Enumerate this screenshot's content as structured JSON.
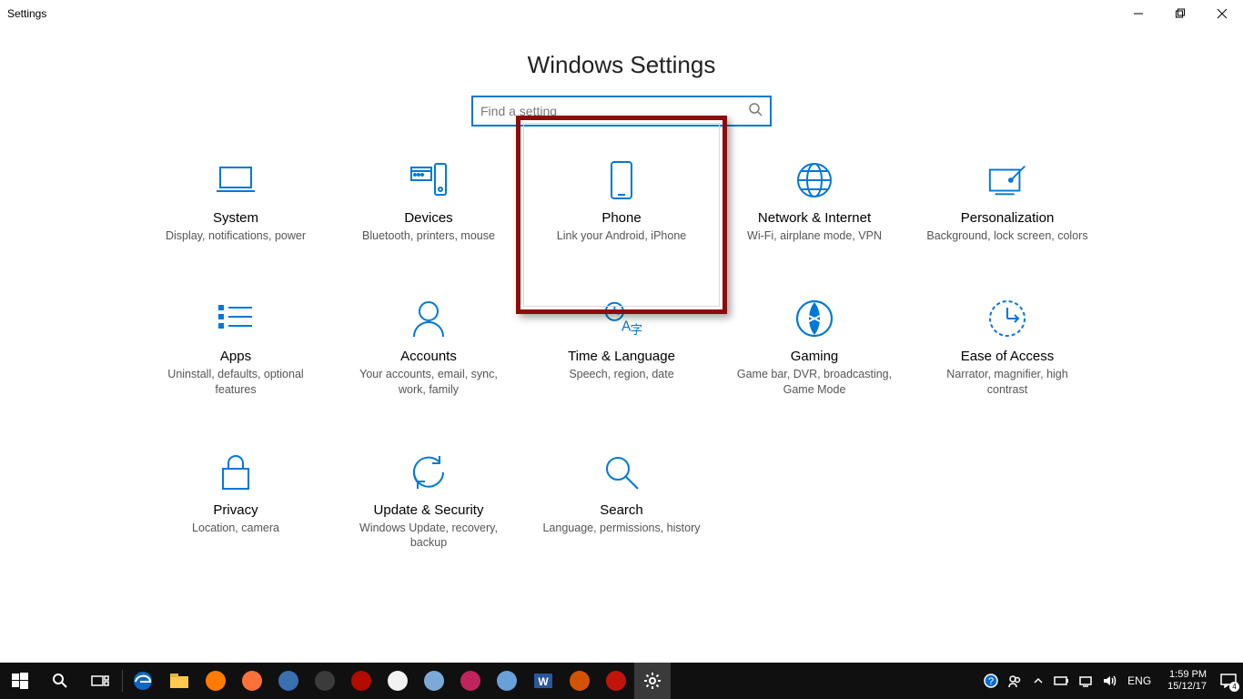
{
  "window": {
    "title": "Settings"
  },
  "header": {
    "title": "Windows Settings"
  },
  "search": {
    "placeholder": "Find a setting"
  },
  "categories": [
    {
      "id": "system",
      "name": "System",
      "desc": "Display, notifications, power",
      "highlighted": false
    },
    {
      "id": "devices",
      "name": "Devices",
      "desc": "Bluetooth, printers, mouse",
      "highlighted": false
    },
    {
      "id": "phone",
      "name": "Phone",
      "desc": "Link your Android, iPhone",
      "highlighted": true
    },
    {
      "id": "network",
      "name": "Network & Internet",
      "desc": "Wi-Fi, airplane mode, VPN",
      "highlighted": false
    },
    {
      "id": "personalization",
      "name": "Personalization",
      "desc": "Background, lock screen, colors",
      "highlighted": false
    },
    {
      "id": "apps",
      "name": "Apps",
      "desc": "Uninstall, defaults, optional features",
      "highlighted": false
    },
    {
      "id": "accounts",
      "name": "Accounts",
      "desc": "Your accounts, email, sync, work, family",
      "highlighted": false
    },
    {
      "id": "time",
      "name": "Time & Language",
      "desc": "Speech, region, date",
      "highlighted": false
    },
    {
      "id": "gaming",
      "name": "Gaming",
      "desc": "Game bar, DVR, broadcasting, Game Mode",
      "highlighted": false
    },
    {
      "id": "ease",
      "name": "Ease of Access",
      "desc": "Narrator, magnifier, high contrast",
      "highlighted": false
    },
    {
      "id": "privacy",
      "name": "Privacy",
      "desc": "Location, camera",
      "highlighted": false
    },
    {
      "id": "update",
      "name": "Update & Security",
      "desc": "Windows Update, recovery, backup",
      "highlighted": false
    },
    {
      "id": "search",
      "name": "Search",
      "desc": "Language, permissions, history",
      "highlighted": false
    }
  ],
  "taskbar": {
    "apps": [
      {
        "id": "edge",
        "color": "#0e66c2"
      },
      {
        "id": "explorer",
        "color": "#ffca4b"
      },
      {
        "id": "media",
        "color": "#ff7b00"
      },
      {
        "id": "firefox",
        "color": "#ff7139"
      },
      {
        "id": "reader",
        "color": "#3a6fb0"
      },
      {
        "id": "chromeA",
        "color": "#3b3b3b"
      },
      {
        "id": "acrobat",
        "color": "#b30b00"
      },
      {
        "id": "chrome",
        "color": "#f2f2f2"
      },
      {
        "id": "paint",
        "color": "#7da9d8"
      },
      {
        "id": "xiu",
        "color": "#c0245c"
      },
      {
        "id": "notes",
        "color": "#6aa0d8"
      },
      {
        "id": "word",
        "color": "#2b579a"
      },
      {
        "id": "orange",
        "color": "#d35400"
      },
      {
        "id": "ringred",
        "color": "#c2140a"
      },
      {
        "id": "settings",
        "color": "#333333",
        "active": true
      }
    ],
    "lang": "ENG",
    "clock": {
      "time": "1:59 PM",
      "date": "15/12/17"
    },
    "notification_badge": "4"
  }
}
